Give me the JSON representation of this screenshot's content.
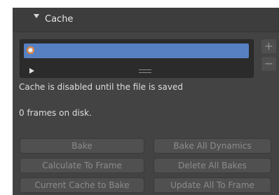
{
  "panel": {
    "title": "Cache",
    "disabled_note": "Cache is disabled until the file is saved",
    "frames_info": "0 frames on disk.",
    "list": {
      "items": [
        {
          "icon": "cache-icon",
          "label": "",
          "selected": true
        }
      ]
    },
    "side_buttons": {
      "add": "+",
      "remove": "−"
    },
    "buttons": {
      "bake": "Bake",
      "bake_all_dynamics": "Bake All Dynamics",
      "calculate_to_frame": "Calculate To Frame",
      "delete_all_bakes": "Delete All Bakes",
      "current_cache_to_bake": "Current Cache to Bake",
      "update_all_to_frame": "Update All To Frame"
    }
  },
  "colors": {
    "panel_bg": "#434343",
    "list_bg": "#2b2b2b",
    "selected_row": "#5680c2",
    "disabled_button_text": "#8c8c8c"
  }
}
